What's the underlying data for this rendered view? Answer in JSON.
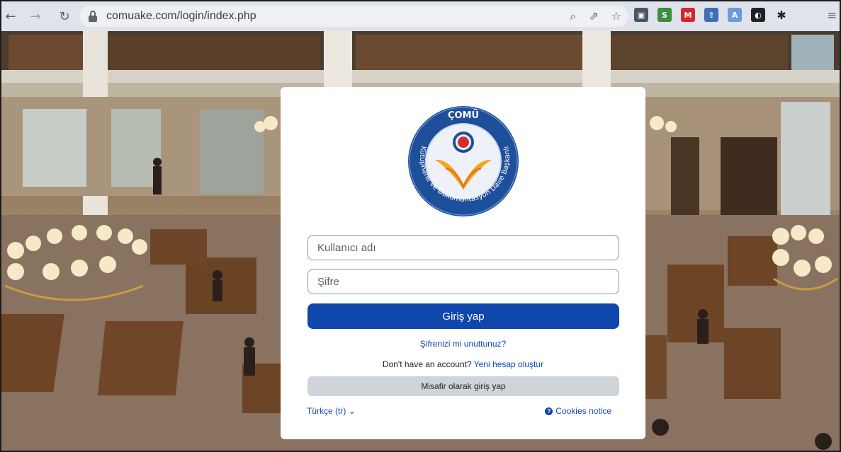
{
  "browser": {
    "url": "comuake.com/login/index.php",
    "back_icon": "arrow-left-icon",
    "forward_icon": "arrow-right-icon",
    "reload_icon": "reload-icon"
  },
  "login": {
    "username_placeholder": "Kullanıcı adı",
    "password_placeholder": "Şifre",
    "login_button": "Giriş yap",
    "forgot_link": "Şifrenizi mi unuttunuz?",
    "signup_prompt": "Don't have an account?",
    "signup_link": "Yeni hesap oluştur",
    "guest_button": "Misafir olarak giriş yap",
    "language": "Türkçe (tr)",
    "cookies": "Cookies notice"
  },
  "logo": {
    "top_text": "ÇOMÜ",
    "ring_text": "Kütüphane ve Dokümantasyon Daire Başkanlığı"
  },
  "colors": {
    "primary": "#0f47ad",
    "guest_button": "#ced4da",
    "logo_ring": "#1d4f9a"
  }
}
